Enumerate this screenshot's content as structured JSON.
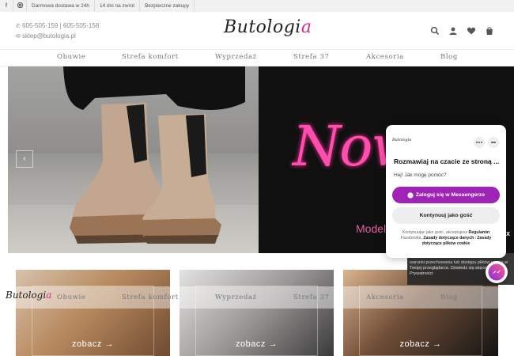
{
  "topbar": {
    "social": [
      "facebook-icon",
      "instagram-icon"
    ],
    "messages": [
      "Darmowa dostawa w 24h",
      "14 dni na zwrot",
      "Bezpieczne zakupy"
    ]
  },
  "header": {
    "phone": "605-505-159 | 605-505-158",
    "email": "sklep@butologia.pl",
    "logo_main": "Butologi",
    "logo_accent": "a",
    "icons": [
      "search-icon",
      "user-icon",
      "heart-icon",
      "cart-icon"
    ]
  },
  "nav": {
    "items": [
      "Obuwie",
      "Strefa komfort",
      "Wyprzedaż",
      "Strefa 37",
      "Akcesoria",
      "Blog"
    ]
  },
  "hero": {
    "neon_text": "Now",
    "subtitle": "Model",
    "prev_arrow": "‹"
  },
  "cards": [
    {
      "label": "zobacz",
      "arrow": "→"
    },
    {
      "label": "zobacz",
      "arrow": "→"
    },
    {
      "label": "zobacz",
      "arrow": "→"
    }
  ],
  "sticky": {
    "logo_main": "Butologi",
    "logo_accent": "a"
  },
  "cookie": {
    "text": "analizować ruch na stronie. Możesz określić warunki przechowania lub dostępu plików cookie w Twojej przeglądarce. Dowiedz się więcej Polityce Prywatności",
    "close": "x"
  },
  "chat": {
    "head_logo": "Butologia",
    "title": "Rozmawiaj na czacie ze stroną ...",
    "greeting": "Hej! Jak mogę pomóc?",
    "primary_button": "Zaloguj się w Messengerze",
    "secondary_button": "Kontynuuj jako gość",
    "legal_prefix": "Kontynuując jako gość, akceptujesz",
    "legal_link1": "Regulamin",
    "legal_mid": "Facebooka,",
    "legal_link2": "Zasady dotyczące danych",
    "legal_and": "i",
    "legal_link3": "Zasady dotyczące plików cookie"
  },
  "colors": {
    "accent": "#d9298c",
    "neon": "#ff4fae",
    "messenger": "#a023b7"
  }
}
